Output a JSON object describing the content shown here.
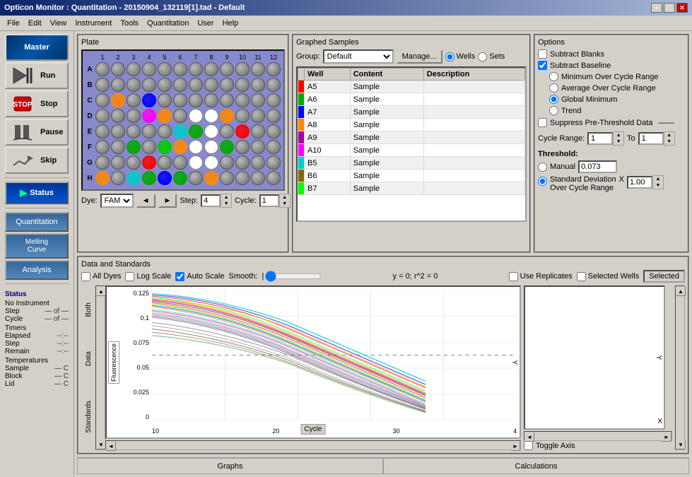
{
  "window": {
    "title": "Opticon Monitor : Quantitation - 20150904_132119[1].tad - Default",
    "min_label": "−",
    "max_label": "□",
    "close_label": "✕"
  },
  "menu": {
    "items": [
      "File",
      "Edit",
      "View",
      "Instrument",
      "Tools",
      "Quantitation",
      "User",
      "Help"
    ]
  },
  "sidebar": {
    "master_label": "Master",
    "run_label": "Run",
    "stop_label": "Stop",
    "pause_label": "Pause",
    "skip_label": "Skip",
    "status_label": "Status",
    "quantitation_label": "Quantitation",
    "melting_label": "Melting\nCurve",
    "analysis_label": "Analysis",
    "status_section": {
      "title": "Status",
      "instrument": "No Instrument",
      "step_label": "Step",
      "step_value": "— of —",
      "cycle_label": "Cycle",
      "cycle_value": "— of —",
      "timers_label": "Timers",
      "elapsed_label": "Elapsed",
      "elapsed_value": "--:--",
      "step_timer_label": "Step",
      "step_timer_value": "--:--",
      "remain_label": "Remain",
      "remain_value": "--:--",
      "temperatures_label": "Temperatures",
      "sample_label": "Sample",
      "sample_value": "— C",
      "block_label": "Block",
      "block_value": "— C",
      "lid_label": "Lid",
      "lid_value": "— C"
    }
  },
  "plate": {
    "title": "Plate",
    "col_headers": [
      "1",
      "2",
      "3",
      "4",
      "5",
      "6",
      "7",
      "8",
      "9",
      "10",
      "11",
      "12"
    ],
    "row_headers": [
      "A",
      "B",
      "C",
      "D",
      "E",
      "F",
      "G",
      "H"
    ],
    "dye_label": "Dye:",
    "dye_value": "FAM",
    "step_label": "Step:",
    "step_value": "4",
    "cycle_label": "Cycle:",
    "cycle_value": "1"
  },
  "graphed_samples": {
    "title": "Graphed Samples",
    "group_label": "Group:",
    "group_value": "Default",
    "manage_label": "Manage...",
    "wells_label": "Wells",
    "sets_label": "Sets",
    "table_headers": [
      "Well",
      "Content",
      "Description"
    ],
    "rows": [
      {
        "color": "#ff0000",
        "well": "A5",
        "content": "Sample",
        "desc": ""
      },
      {
        "color": "#00aa00",
        "well": "A6",
        "content": "Sample",
        "desc": ""
      },
      {
        "color": "#0000ff",
        "well": "A7",
        "content": "Sample",
        "desc": ""
      },
      {
        "color": "#ff8800",
        "well": "A8",
        "content": "Sample",
        "desc": ""
      },
      {
        "color": "#aa00aa",
        "well": "A9",
        "content": "Sample",
        "desc": ""
      },
      {
        "color": "#ff00ff",
        "well": "A10",
        "content": "Sample",
        "desc": ""
      },
      {
        "color": "#00cccc",
        "well": "B5",
        "content": "Sample",
        "desc": ""
      },
      {
        "color": "#886600",
        "well": "B6",
        "content": "Sample",
        "desc": ""
      },
      {
        "color": "#00ff00",
        "well": "B7",
        "content": "Sample",
        "desc": ""
      }
    ]
  },
  "options": {
    "title": "Options",
    "subtract_blanks_label": "Subtract Blanks",
    "subtract_baseline_label": "Subtract Baseline",
    "min_over_cycle_label": "Minimum Over Cycle Range",
    "avg_over_cycle_label": "Average Over Cycle Range",
    "global_min_label": "Global Minimum",
    "trend_label": "Trend",
    "suppress_label": "Suppress Pre-Threshold Data",
    "cycle_range_label": "Cycle Range:",
    "cycle_from": "1",
    "cycle_to_label": "To",
    "cycle_to": "1",
    "threshold_label": "Threshold:",
    "manual_label": "Manual",
    "manual_value": "0.073",
    "std_dev_label": "Standard Deviation\nOver Cycle Range",
    "std_dev_mult": "X",
    "std_dev_value": "1.00"
  },
  "data_standards": {
    "title": "Data and Standards",
    "all_dyes_label": "All Dyes",
    "log_scale_label": "Log Scale",
    "auto_scale_label": "Auto Scale",
    "smooth_label": "Smooth:",
    "equation_label": "y = 0;  r^2 = 0",
    "use_replicates_label": "Use Replicates",
    "selected_wells_label": "Selected Wells",
    "selected_label": "Selected",
    "both_label": "Both",
    "data_label": "Data",
    "standards_label": "Standards",
    "y_axis_label": "Y",
    "x_axis_label": "X",
    "fluorescence_label": "Fluorescence",
    "cycle_axis_label": "Cycle",
    "toggle_axis_label": "Toggle Axis",
    "chart": {
      "y_ticks": [
        "0.125",
        "0.1",
        "0.075",
        "0.05",
        "0.025",
        "0"
      ],
      "x_ticks": [
        "10",
        "20",
        "30",
        "4"
      ]
    }
  },
  "bottom_tabs": {
    "graphs_label": "Graphs",
    "calculations_label": "Calculations"
  },
  "wells_colors": [
    "#888888",
    "#888888",
    "#888888",
    "#888888",
    "#888888",
    "#888888",
    "#888888",
    "#888888",
    "#888888",
    "#888888",
    "#888888",
    "#888888",
    "#888888",
    "#888888",
    "#888888",
    "#888888",
    "#888888",
    "#888888",
    "#888888",
    "#888888",
    "#888888",
    "#888888",
    "#888888",
    "#888888",
    "#888888",
    "#ff8800",
    "#888888",
    "#0000ff",
    "#888888",
    "#888888",
    "#888888",
    "#888888",
    "#888888",
    "#888888",
    "#888888",
    "#888888",
    "#888888",
    "#888888",
    "#888888",
    "#ff00ff",
    "#ff8800",
    "#888888",
    "#ffffff",
    "#ffffff",
    "#ff8800",
    "#888888",
    "#888888",
    "#888888",
    "#888888",
    "#888888",
    "#888888",
    "#888888",
    "#888888",
    "#00cccc",
    "#00aa00",
    "#ffffff",
    "#888888",
    "#ff0000",
    "#888888",
    "#888888",
    "#888888",
    "#888888",
    "#00aa00",
    "#888888",
    "#00cc00",
    "#ff8800",
    "#ffffff",
    "#ffffff",
    "#00aa00",
    "#888888",
    "#888888",
    "#888888",
    "#888888",
    "#888888",
    "#888888",
    "#ff0000",
    "#888888",
    "#888888",
    "#ffffff",
    "#ffffff",
    "#888888",
    "#888888",
    "#888888",
    "#888888",
    "#ff8800",
    "#888888",
    "#00cccc",
    "#00aa00",
    "#0000ff",
    "#00aa00",
    "#888888",
    "#ff8800",
    "#888888",
    "#888888",
    "#888888",
    "#888888"
  ]
}
